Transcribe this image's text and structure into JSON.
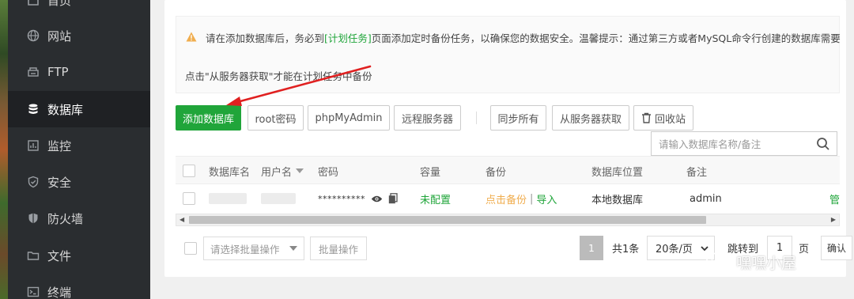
{
  "sidebar": {
    "items": [
      {
        "label": "首页",
        "icon": "home-icon",
        "active": false
      },
      {
        "label": "网站",
        "icon": "globe-icon",
        "active": false
      },
      {
        "label": "FTP",
        "icon": "ftp-icon",
        "active": false
      },
      {
        "label": "数据库",
        "icon": "database-icon",
        "active": true
      },
      {
        "label": "监控",
        "icon": "monitor-icon",
        "active": false
      },
      {
        "label": "安全",
        "icon": "shield-check-icon",
        "active": false
      },
      {
        "label": "防火墙",
        "icon": "firewall-icon",
        "active": false
      },
      {
        "label": "文件",
        "icon": "folder-icon",
        "active": false
      },
      {
        "label": "终端",
        "icon": "terminal-icon",
        "active": false
      }
    ]
  },
  "notice": {
    "line1_prefix": "请在添加数据库后，务必到",
    "line1_link": "[计划任务]",
    "line1_suffix": "页面添加定时备份任务，以确保您的数据安全。温馨提示：通过第三方或者MySQL命令行创建的数据库需要",
    "line2": "点击\"从服务器获取\"才能在计划任务中备份"
  },
  "toolbar": {
    "add_db": "添加数据库",
    "root_pwd": "root密码",
    "phpmyadmin": "phpMyAdmin",
    "remote_server": "远程服务器",
    "sync_all": "同步所有",
    "get_from_server": "从服务器获取",
    "recycle_bin": "回收站"
  },
  "search": {
    "placeholder": "请输入数据库名称/备注"
  },
  "table": {
    "headers": {
      "name": "数据库名",
      "user": "用户名",
      "password": "密码",
      "capacity": "容量",
      "backup": "备份",
      "location": "数据库位置",
      "remark": "备注"
    },
    "rows": [
      {
        "password": "**********",
        "capacity": "未配置",
        "backup_link": "点击备份",
        "backup_sep": "|",
        "import_link": "导入",
        "location": "本地数据库",
        "remark": "admin",
        "action_partial": "管"
      }
    ]
  },
  "footer": {
    "batch_placeholder": "请选择批量操作",
    "batch_button": "批量操作",
    "page_current": "1",
    "total": "共1条",
    "per_page": "20条/页",
    "goto_label": "跳转到",
    "goto_value": "1",
    "page_unit": "页",
    "confirm": "确认"
  },
  "watermark": {
    "text": "嘿嘿小屋"
  },
  "colors": {
    "accent": "#20a53a",
    "sidebar_bg": "#2a2d30",
    "warning": "#f0ad4e",
    "annotation_arrow": "#e02020"
  }
}
